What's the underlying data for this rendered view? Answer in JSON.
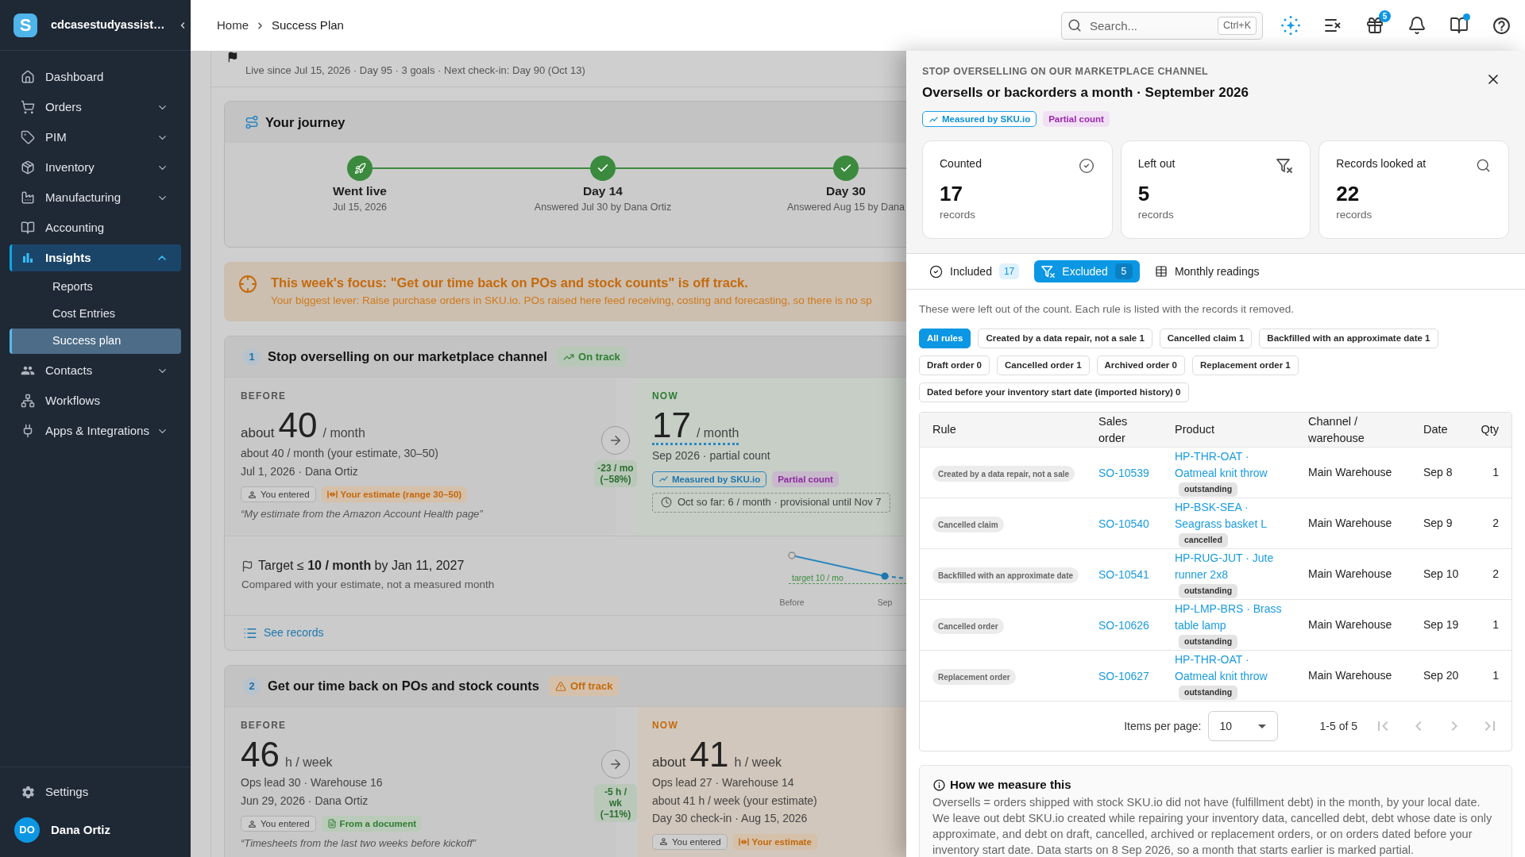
{
  "sidebar": {
    "logo": "S",
    "workspace": "cdcasestudyassist…",
    "items": [
      {
        "label": "Dashboard",
        "selected": false
      },
      {
        "label": "Orders",
        "selected": false,
        "expanded": false
      },
      {
        "label": "PIM",
        "selected": false,
        "expanded": false
      },
      {
        "label": "Inventory",
        "selected": false,
        "expanded": false
      },
      {
        "label": "Manufacturing",
        "selected": false,
        "expanded": false
      },
      {
        "label": "Accounting",
        "selected": false
      },
      {
        "label": "Insights",
        "selected": true,
        "expanded": true,
        "children": [
          {
            "label": "Reports",
            "selected": false
          },
          {
            "label": "Cost Entries",
            "selected": false
          },
          {
            "label": "Success plan",
            "selected": true
          }
        ]
      },
      {
        "label": "Contacts",
        "selected": false,
        "expanded": false
      },
      {
        "label": "Workflows",
        "selected": false
      },
      {
        "label": "Apps & Integrations",
        "selected": false,
        "expanded": false
      }
    ],
    "settings": "Settings",
    "user": {
      "initials": "DO",
      "name": "Dana Ortiz"
    }
  },
  "breadcrumb": [
    "Home",
    "Success Plan"
  ],
  "search": {
    "placeholder": "Search...",
    "shortcut": "Ctrl+K"
  },
  "toolbar": {
    "badge_count": "5",
    "unread_dot": true
  },
  "page": {
    "subtitle": "Live since Jul 15, 2026 · Day 95 · 3 goals · Next check-in: Day 90 (Oct 13)"
  },
  "journey": {
    "title": "Your journey",
    "steps": [
      {
        "kind": "start",
        "label": "Went live",
        "detail": "Jul 15, 2026",
        "done": true
      },
      {
        "kind": "checkpoint",
        "label": "Day 14",
        "detail": "Answered Jul 30 by Dana Ortiz",
        "done": true
      },
      {
        "kind": "checkpoint",
        "label": "Day 30",
        "detail": "Answered Aug 15 by Dana",
        "done": true
      }
    ]
  },
  "focus": {
    "title": "This week's focus: \"Get our time back on POs and stock counts\" is off track.",
    "text": "Your biggest lever: Raise purchase orders in SKU.io. POs raised here feed receiving, costing and forecasting, so there is no sp"
  },
  "goals": [
    {
      "number": "1",
      "title": "Stop overselling on our marketplace channel",
      "status": {
        "kind": "on_track",
        "label": "On track"
      },
      "before": {
        "label": "BEFORE",
        "prefix": "about",
        "value": "40",
        "unit": "/ month",
        "lines": [
          "about 40 / month (your estimate, 30–50)",
          "Jul 1, 2026 · Dana Ortiz"
        ],
        "tags": [
          {
            "kind": "entered",
            "label": "You entered"
          },
          {
            "kind": "estimate",
            "label": "Your estimate (range 30–50)"
          }
        ],
        "note": "“My estimate from the Amazon Account Health page”"
      },
      "change": "-23 / mo (−58%)",
      "now": {
        "label": "NOW",
        "value": "17",
        "unit": "/ month",
        "measured": true,
        "lines": [
          "Sep 2026 · partial count"
        ],
        "tags": [
          {
            "kind": "measured",
            "label": "Measured by SKU.io"
          },
          {
            "kind": "partial",
            "label": "Partial count"
          }
        ],
        "provisional": "Oct so far: 6 / month · provisional until Nov 7"
      },
      "target": {
        "text": "Target ≤ **10 / month** by Jan 11, 2027",
        "note": "Compared with your estimate, not a measured month",
        "trend": {
          "target_label": "target 10 / mo",
          "x_labels": [
            "Before",
            "Sep"
          ]
        }
      },
      "link": "See records"
    },
    {
      "number": "2",
      "title": "Get our time back on POs and stock counts",
      "status": {
        "kind": "off_track",
        "label": "Off track"
      },
      "before": {
        "label": "BEFORE",
        "value": "46",
        "unit": "h / week",
        "lines": [
          "Ops lead 30 · Warehouse 16",
          "Jun 29, 2026 · Dana Ortiz"
        ],
        "tags": [
          {
            "kind": "entered",
            "label": "You entered"
          },
          {
            "kind": "document",
            "label": "From a document"
          }
        ],
        "note": "“Timesheets from the last two weeks before kickoff”"
      },
      "change": "-5 h / wk (−11%)",
      "now": {
        "label": "NOW",
        "prefix": "about",
        "value": "41",
        "unit": "h / week",
        "lines": [
          "Ops lead 27 · Warehouse 14",
          "about 41 h / week (your estimate)",
          "Day 30 check-in · Aug 15, 2026"
        ],
        "tags": [
          {
            "kind": "entered",
            "label": "You entered"
          },
          {
            "kind": "estimate",
            "label": "Your estimate"
          }
        ]
      }
    }
  ],
  "drawer": {
    "eyebrow": "STOP OVERSELLING ON OUR MARKETPLACE CHANNEL",
    "title": "Oversells or backorders a month · September 2026",
    "tags": [
      {
        "kind": "measured",
        "label": "Measured by SKU.io"
      },
      {
        "kind": "partial",
        "label": "Partial count"
      }
    ],
    "stats": [
      {
        "label": "Counted",
        "value": "17",
        "unit": "records"
      },
      {
        "label": "Left out",
        "value": "5",
        "unit": "records"
      },
      {
        "label": "Records looked at",
        "value": "22",
        "unit": "records"
      }
    ],
    "tabs": [
      {
        "label": "Included",
        "count": "17",
        "selected": false
      },
      {
        "label": "Excluded",
        "count": "5",
        "selected": true
      },
      {
        "label": "Monthly readings",
        "selected": false
      }
    ],
    "description": "These were left out of the count. Each rule is listed with the records it removed.",
    "filters": [
      {
        "label": "All rules",
        "selected": true
      },
      {
        "label": "Created by a data repair, not a sale 1",
        "selected": false
      },
      {
        "label": "Cancelled claim 1",
        "selected": false
      },
      {
        "label": "Backfilled with an approximate date 1",
        "selected": false
      },
      {
        "label": "Draft order 0",
        "selected": false
      },
      {
        "label": "Cancelled order 1",
        "selected": false
      },
      {
        "label": "Archived order 0",
        "selected": false
      },
      {
        "label": "Replacement order 1",
        "selected": false
      },
      {
        "label": "Dated before your inventory start date (imported history) 0",
        "selected": false
      }
    ],
    "table": {
      "columns": [
        "Rule",
        "Sales order",
        "Product",
        "Channel / warehouse",
        "Date",
        "Qty"
      ],
      "rows": [
        {
          "rule": "Created by a data repair, not a sale",
          "order": "SO-10539",
          "product": "HP-THR-OAT · Oatmeal knit throw",
          "status": "outstanding",
          "channel": "Main Warehouse",
          "date": "Sep 8",
          "qty": "1"
        },
        {
          "rule": "Cancelled claim",
          "order": "SO-10540",
          "product": "HP-BSK-SEA · Seagrass basket L",
          "status": "cancelled",
          "channel": "Main Warehouse",
          "date": "Sep 9",
          "qty": "2"
        },
        {
          "rule": "Backfilled with an approximate date",
          "order": "SO-10541",
          "product": "HP-RUG-JUT · Jute runner 2x8",
          "status": "outstanding",
          "channel": "Main Warehouse",
          "date": "Sep 10",
          "qty": "2"
        },
        {
          "rule": "Cancelled order",
          "order": "SO-10626",
          "product": "HP-LMP-BRS · Brass table lamp",
          "status": "outstanding",
          "channel": "Main Warehouse",
          "date": "Sep 19",
          "qty": "1"
        },
        {
          "rule": "Replacement order",
          "order": "SO-10627",
          "product": "HP-THR-OAT · Oatmeal knit throw",
          "status": "outstanding",
          "channel": "Main Warehouse",
          "date": "Sep 20",
          "qty": "1"
        }
      ]
    },
    "pagination": {
      "label": "Items per page:",
      "page_size": "10",
      "range": "1-5 of 5",
      "nav_disabled": true
    },
    "info": {
      "title": "How we measure this",
      "text": "Oversells = orders shipped with stock SKU.io did not have (fulfillment debt) in the month, by your local date. We leave out debt SKU.io created while repairing your inventory data, cancelled debt, debt whose date is only approximate, and debt on draft, cancelled, archived or replacement orders, or on orders dated before your inventory start date. Data starts on 8 Sep 2026, so a month that starts earlier is marked partial."
    }
  }
}
